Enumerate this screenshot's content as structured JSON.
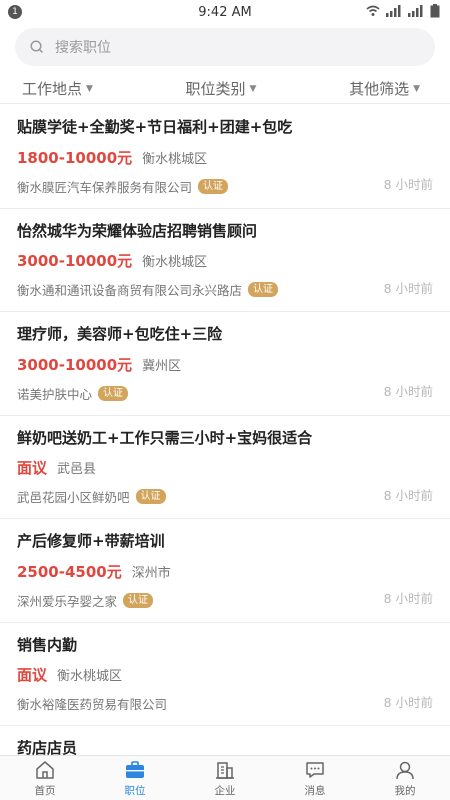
{
  "status_bar": {
    "time": "9:42 AM",
    "notification_count": "1"
  },
  "search": {
    "placeholder": "搜索职位"
  },
  "filters": [
    {
      "label": "工作地点"
    },
    {
      "label": "职位类别"
    },
    {
      "label": "其他筛选"
    }
  ],
  "jobs": [
    {
      "title": "贴膜学徒+全勤奖+节日福利+团建+包吃",
      "salary": "1800-10000元",
      "area": "衡水桃城区",
      "company": "衡水膜匠汽车保养服务有限公司",
      "badge": "认证",
      "posted": "8 小时前"
    },
    {
      "title": "怡然城华为荣耀体验店招聘销售顾问",
      "salary": "3000-10000元",
      "area": "衡水桃城区",
      "company": "衡水通和通讯设备商贸有限公司永兴路店",
      "badge": "认证",
      "posted": "8 小时前"
    },
    {
      "title": "理疗师，美容师+包吃住+三险",
      "salary": "3000-10000元",
      "area": "冀州区",
      "company": "诺美护肤中心",
      "badge": "认证",
      "posted": "8 小时前"
    },
    {
      "title": "鲜奶吧送奶工+工作只需三小时+宝妈很适合",
      "salary": "面议",
      "area": "武邑县",
      "company": "武邑花园小区鲜奶吧",
      "badge": "认证",
      "posted": "8 小时前"
    },
    {
      "title": "产后修复师+带薪培训",
      "salary": "2500-4500元",
      "area": "深州市",
      "company": "深州爱乐孕婴之家",
      "badge": "认证",
      "posted": "8 小时前"
    },
    {
      "title": "销售内勤",
      "salary": "面议",
      "area": "衡水桃城区",
      "company": "衡水裕隆医药贸易有限公司",
      "badge": "",
      "posted": "8 小时前"
    },
    {
      "title": "药店店员"
    }
  ],
  "tabs": [
    {
      "label": "首页",
      "icon": "home-icon"
    },
    {
      "label": "职位",
      "icon": "briefcase-icon",
      "active": true
    },
    {
      "label": "企业",
      "icon": "building-icon"
    },
    {
      "label": "消息",
      "icon": "message-icon"
    },
    {
      "label": "我的",
      "icon": "user-icon"
    }
  ],
  "colors": {
    "accent": "#2a86e0",
    "salary": "#e0483f",
    "badge": "#d3a45c"
  }
}
